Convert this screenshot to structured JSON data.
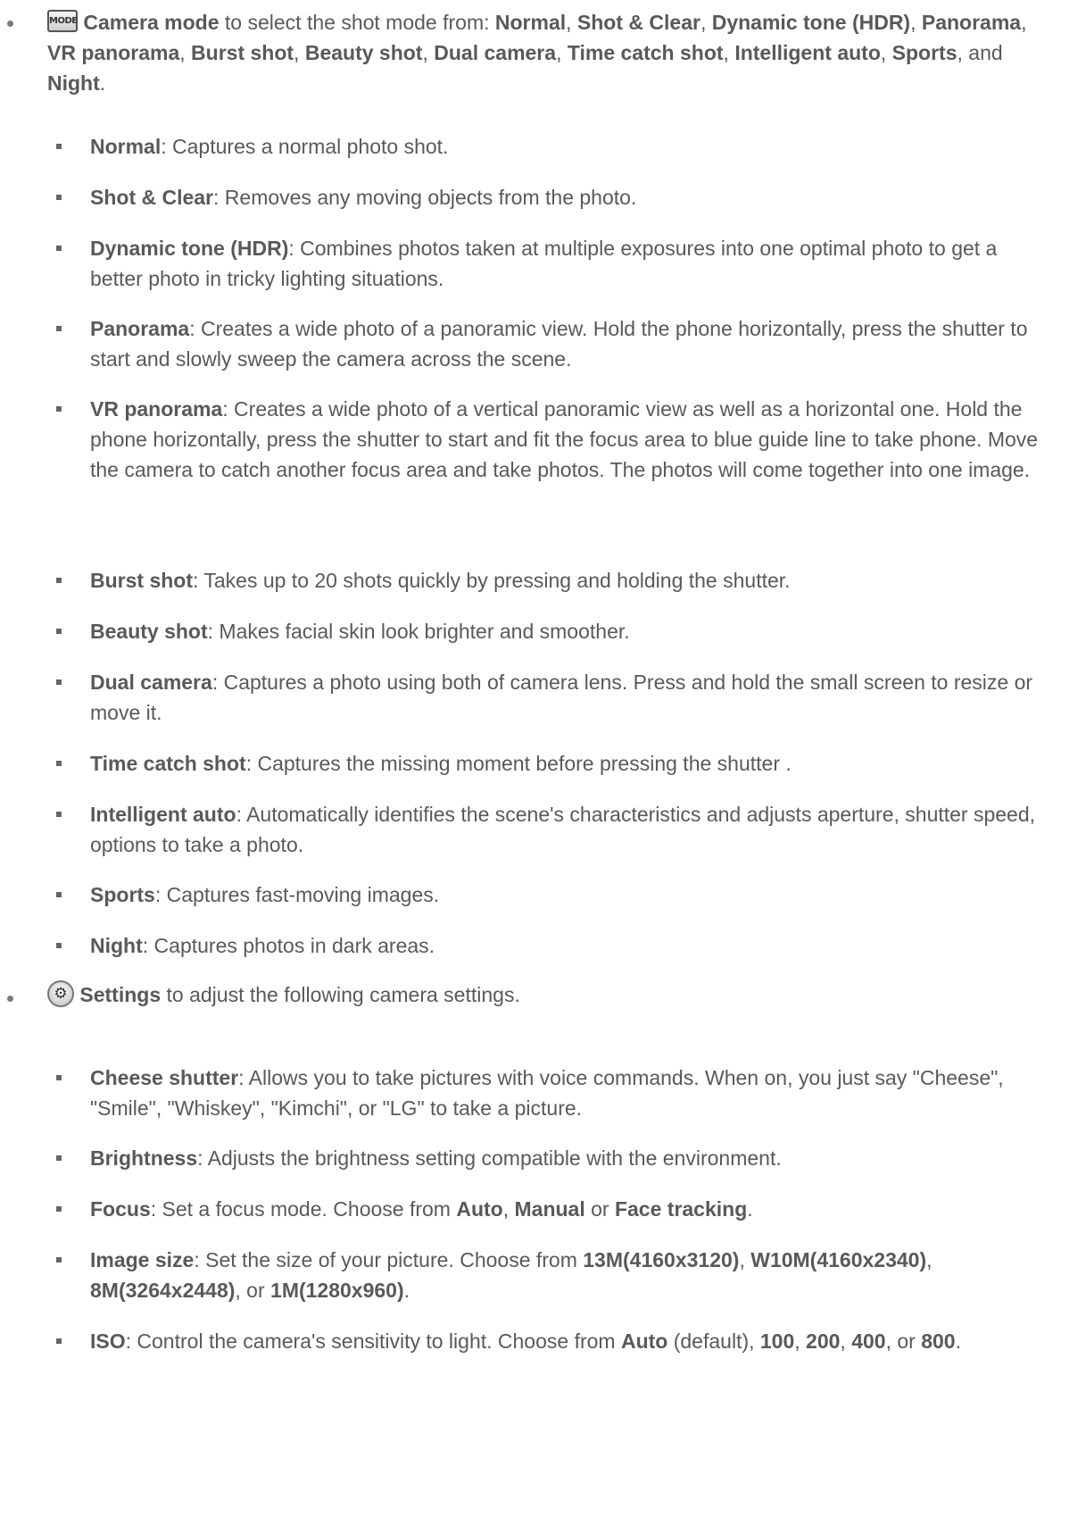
{
  "camera_mode": {
    "icon_label": "MODE",
    "title": "Camera mode",
    "intro": " to select the shot mode from: ",
    "list": [
      {
        "text": "Normal",
        "b": true
      },
      {
        "text": ", ",
        "b": false
      },
      {
        "text": "Shot & Clear",
        "b": true
      },
      {
        "text": ", ",
        "b": false
      },
      {
        "text": "Dynamic tone (HDR)",
        "b": true
      },
      {
        "text": ", ",
        "b": false
      },
      {
        "text": "Panorama",
        "b": true
      },
      {
        "text": ", ",
        "b": false
      },
      {
        "text": "VR panorama",
        "b": true
      },
      {
        "text": ", ",
        "b": false
      },
      {
        "text": "Burst shot",
        "b": true
      },
      {
        "text": ", ",
        "b": false
      },
      {
        "text": "Beauty shot",
        "b": true
      },
      {
        "text": ", ",
        "b": false
      },
      {
        "text": "Dual camera",
        "b": true
      },
      {
        "text": ", ",
        "b": false
      },
      {
        "text": "Time catch shot",
        "b": true
      },
      {
        "text": ", ",
        "b": false
      },
      {
        "text": "Intelligent auto",
        "b": true
      },
      {
        "text": ", ",
        "b": false
      },
      {
        "text": "Sports",
        "b": true
      },
      {
        "text": ", and ",
        "b": false
      },
      {
        "text": "Night",
        "b": true
      },
      {
        "text": ".",
        "b": false
      }
    ],
    "modes": [
      {
        "name": "Normal",
        "desc": ": Captures a normal photo shot."
      },
      {
        "name": "Shot & Clear",
        "desc": ":  Removes any moving objects from the photo."
      },
      {
        "name": "Dynamic tone (HDR)",
        "desc": ": Combines photos taken at multiple exposures into one optimal photo to get a better photo in tricky lighting situations."
      },
      {
        "name": "Panorama",
        "desc": ": Creates a wide photo of a panoramic view. Hold the phone horizontally, press the shutter to start and slowly sweep the camera across the scene."
      },
      {
        "name": "VR panorama",
        "desc": ": Creates a wide photo of a vertical panoramic view as well as a horizontal one. Hold the phone horizontally, press the shutter to start and fit the focus area to blue guide line to take phone. Move the camera to catch another focus area and take photos. The photos will come together into one image."
      },
      {
        "name": "Burst shot",
        "desc": ": Takes up to 20 shots quickly by pressing and holding the shutter."
      },
      {
        "name": "Beauty shot",
        "desc": ": Makes facial skin look brighter and smoother."
      },
      {
        "name": "Dual camera",
        "desc": ": Captures a photo using both of camera lens. Press and hold the small screen to resize or move it."
      },
      {
        "name": "Time catch shot",
        "desc": ": Captures the missing moment before pressing the shutter ."
      },
      {
        "name": "Intelligent auto",
        "desc": ": Automatically identifies the scene's characteristics and adjusts aperture, shutter speed, options to take a photo."
      },
      {
        "name": "Sports",
        "desc": ": Captures fast-moving images."
      },
      {
        "name": "Night",
        "desc": ": Captures photos in dark areas."
      }
    ]
  },
  "settings": {
    "title": "Settings",
    "intro": " to adjust the following camera settings.",
    "cheese": {
      "name": "Cheese shutter",
      "desc": ": Allows you to take pictures with voice commands. When on, you just say \"Cheese\", \"Smile\", \"Whiskey\", \"Kimchi\", or \"LG\" to take a picture."
    },
    "brightness": {
      "name": "Brightness",
      "desc": ": Adjusts the brightness setting compatible with the environment."
    },
    "focus": {
      "name": "Focus",
      "desc": ": Set a focus mode. Choose from ",
      "opt1": "Auto",
      "sep1": ", ",
      "opt2": "Manual",
      "sep2": " or ",
      "opt3": "Face tracking",
      "end": "."
    },
    "image_size": {
      "name": "Image size",
      "desc": ": Set the size of your picture. Choose from ",
      "opt1": "13M(4160x3120)",
      "sep1": ", ",
      "opt2": "W10M(4160x2340)",
      "sep2": ", ",
      "opt3": "8M(3264x2448)",
      "sep3": ", or ",
      "opt4": "1M(1280x960)",
      "end": "."
    },
    "iso": {
      "name": "ISO",
      "desc": ": Control the camera's sensitivity to light. Choose from ",
      "opt1": "Auto",
      "sep1": " (default), ",
      "opt2": "100",
      "sep2": ", ",
      "opt3": "200",
      "sep3": ", ",
      "opt4": "400",
      "sep4": ", or ",
      "opt5": "800",
      "end": "."
    }
  }
}
